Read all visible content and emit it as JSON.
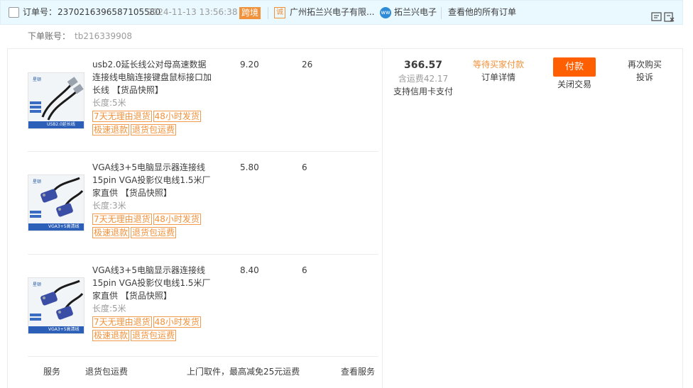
{
  "header": {
    "order_label": "订单号：",
    "order_number": "2370216396587105580",
    "order_date": "2024-11-13 13:56:38",
    "badge": "跨境",
    "shop_icon": "诚",
    "shop_name": "广州拓兰兴电子有限...",
    "wangwang_icon": "ww",
    "seller_name": "拓兰兴电子",
    "all_orders": "查看他的所有订单"
  },
  "account": {
    "label": "下单账号：",
    "value": "tb216339908"
  },
  "items": [
    {
      "title": "usb2.0延长线公对母高速数据连接线电脑连接键盘鼠标接口加长线",
      "snapshot": "【货品快照】",
      "spec": "长度:5米",
      "tags": [
        "7天无理由退货",
        "48小时发货",
        "极速退款",
        "退货包运费"
      ],
      "price": "9.20",
      "qty": "26",
      "thumb_caption": "USB2.0延长线"
    },
    {
      "title": "VGA线3+5电脑显示器连接线15pin VGA投影仪电线1.5米厂家直供",
      "snapshot": "【货品快照】",
      "spec": "长度:3米",
      "tags": [
        "7天无理由退货",
        "48小时发货",
        "极速退款",
        "退货包运费"
      ],
      "price": "5.80",
      "qty": "6",
      "thumb_caption": "VGA3+5高清线"
    },
    {
      "title": "VGA线3+5电脑显示器连接线15pin VGA投影仪电线1.5米厂家直供",
      "snapshot": "【货品快照】",
      "spec": "长度:5米",
      "tags": [
        "7天无理由退货",
        "48小时发货",
        "极速退款",
        "退货包运费"
      ],
      "price": "8.40",
      "qty": "6",
      "thumb_caption": "VGA3+5高清线"
    }
  ],
  "total": {
    "amount": "366.57",
    "shipping": "含运费42.17",
    "card": "支持信用卡支付"
  },
  "status": {
    "state": "等待买家付款",
    "details": "订单详情"
  },
  "actions": {
    "pay": "付款",
    "close": "关闭交易",
    "rebuy": "再次购买",
    "complain": "投诉"
  },
  "service": {
    "label": "服务",
    "name": "退货包运费",
    "desc": "上门取件，最高减免25元运费",
    "view": "查看服务"
  },
  "colors": {
    "accent": "#ff5f00",
    "tag": "#f1913a",
    "header_bg": "#eaf8ff"
  }
}
